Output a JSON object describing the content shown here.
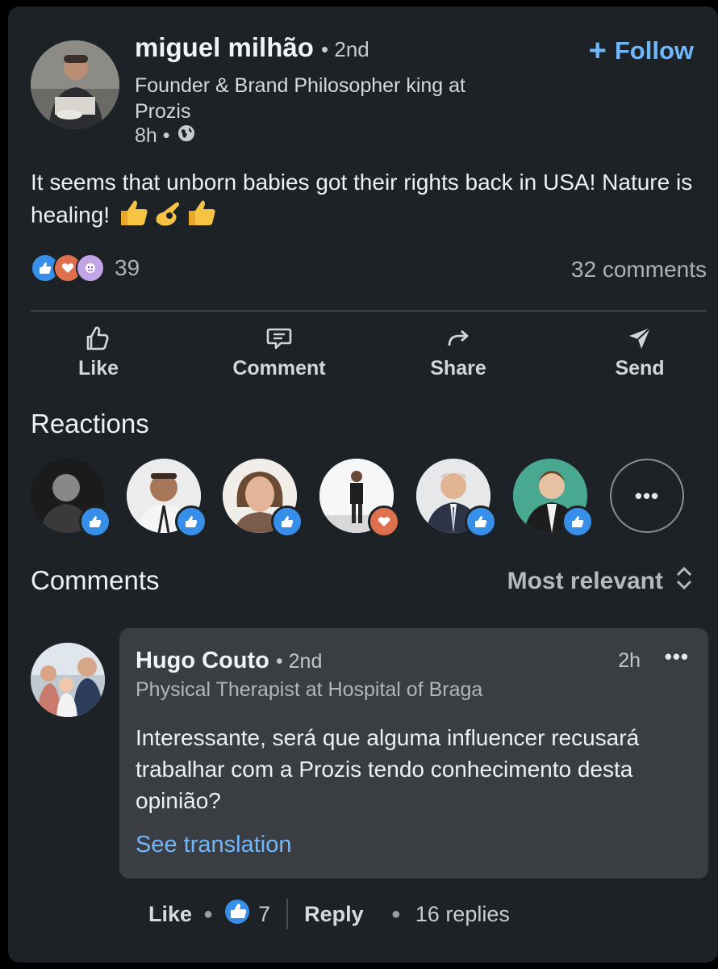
{
  "post": {
    "author_name": "miguel milhão",
    "author_degree": "• 2nd",
    "headline": "Founder & Brand Philosopher king at Prozis",
    "time": "8h •",
    "follow_label": "Follow",
    "follow_icon": "plus-icon",
    "visibility_icon": "globe-icon",
    "text": "It seems that unborn babies got their rights back in USA! Nature is healing!",
    "emojis": [
      "thumbs-up",
      "ok-hand",
      "thumbs-up"
    ],
    "reaction_count": "39",
    "reaction_types": [
      "like",
      "love",
      "insightful"
    ],
    "comments_count": "32 comments"
  },
  "actions": [
    {
      "label": "Like",
      "icon": "thumbs-up-icon"
    },
    {
      "label": "Comment",
      "icon": "comment-icon"
    },
    {
      "label": "Share",
      "icon": "share-icon"
    },
    {
      "label": "Send",
      "icon": "send-icon"
    }
  ],
  "reactions_section": {
    "title": "Reactions",
    "reactors": [
      {
        "badge": "like"
      },
      {
        "badge": "like"
      },
      {
        "badge": "like"
      },
      {
        "badge": "love"
      },
      {
        "badge": "like"
      },
      {
        "badge": "like"
      }
    ],
    "more_label": "•••"
  },
  "comments_section": {
    "title": "Comments",
    "sort_label": "Most relevant",
    "comment": {
      "name": "Hugo Couto",
      "degree": "• 2nd",
      "headline": "Physical Therapist at Hospital of Braga",
      "time": "2h",
      "menu": "•••",
      "text": "Interessante, será que alguma influencer recusará trabalhar com a Prozis tendo conhecimento desta opinião?",
      "translate_label": "See translation",
      "like_label": "Like",
      "like_count": "7",
      "reply_label": "Reply",
      "replies": "16 replies"
    }
  },
  "colors": {
    "background": "#1d2226",
    "accent_blue": "#71b7fb",
    "like_blue": "#378fe9",
    "love_red": "#df704d"
  }
}
